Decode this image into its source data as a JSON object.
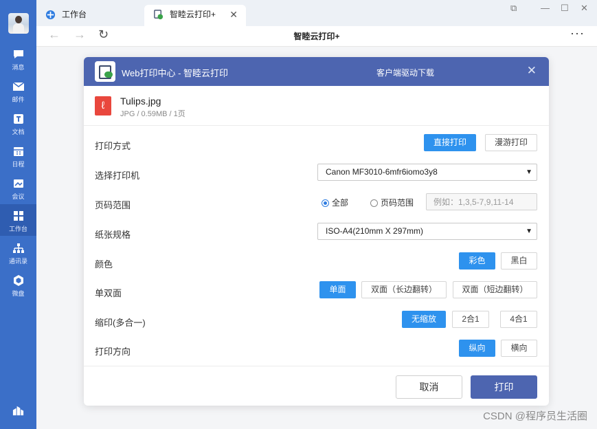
{
  "rail": {
    "items": [
      {
        "label": "消息",
        "icon": "chat-icon"
      },
      {
        "label": "邮件",
        "icon": "mail-icon"
      },
      {
        "label": "文档",
        "icon": "document-icon"
      },
      {
        "label": "日程",
        "icon": "calendar-icon"
      },
      {
        "label": "会议",
        "icon": "meeting-icon"
      },
      {
        "label": "工作台",
        "icon": "workbench-icon",
        "active": true
      },
      {
        "label": "通讯录",
        "icon": "contacts-icon"
      },
      {
        "label": "微盘",
        "icon": "drive-icon"
      }
    ],
    "bottom_icon": "apps-icon"
  },
  "browser": {
    "tabs": [
      {
        "label": "工作台",
        "icon": "workbench-tab-icon"
      },
      {
        "label": "智睦云打印+",
        "icon": "print-tab-icon",
        "close": "✕"
      }
    ],
    "page_title": "智睦云打印+",
    "more": "···"
  },
  "dialog": {
    "title": "Web打印中心 - 智睦云打印",
    "driver_download": "客户端驱动下载",
    "close": "✕",
    "file": {
      "name": "Tulips.jpg",
      "meta": "JPG / 0.59MB / 1页"
    },
    "rows": {
      "print_mode": {
        "label": "打印方式",
        "options": [
          "直接打印",
          "漫游打印"
        ]
      },
      "printer": {
        "label": "选择打印机",
        "value": "Canon MF3010-6mfr6iomo3y8"
      },
      "page_range": {
        "label": "页码范围",
        "options": [
          "全部",
          "页码范围"
        ],
        "placeholder": "例如：1,3,5-7,9,11-14"
      },
      "paper": {
        "label": "纸张规格",
        "value": "ISO-A4(210mm X 297mm)"
      },
      "color": {
        "label": "颜色",
        "options": [
          "彩色",
          "黑白"
        ]
      },
      "duplex": {
        "label": "单双面",
        "options": [
          "单面",
          "双面（长边翻转）",
          "双面（短边翻转）"
        ]
      },
      "nup": {
        "label": "缩印(多合一)",
        "options": [
          "无缩放",
          "2合1",
          "4合1"
        ]
      },
      "orientation": {
        "label": "打印方向",
        "options": [
          "纵向",
          "横向"
        ]
      }
    },
    "cancel_label": "取消",
    "print_label": "打印"
  },
  "watermark": "CSDN @程序员生活圈",
  "colors": {
    "rail": "#3b6fc8",
    "header": "#4d65b0",
    "accent": "#2e92ee",
    "pdf_red": "#e9473d"
  }
}
